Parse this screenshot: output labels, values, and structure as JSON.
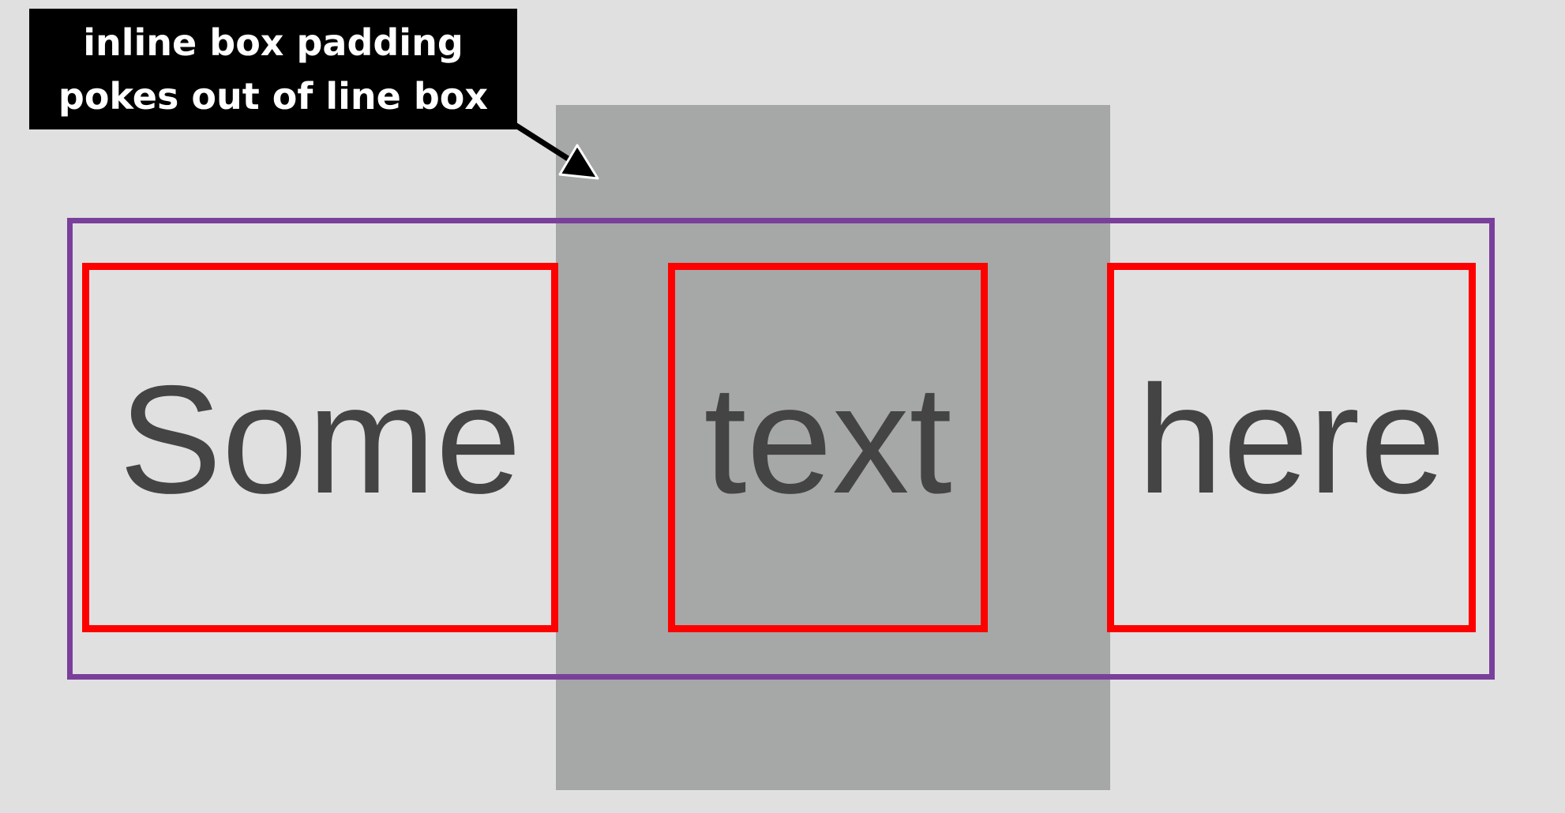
{
  "callout": {
    "line1": "inline box padding",
    "line2": "pokes out of line box"
  },
  "words": [
    {
      "text": "Some"
    },
    {
      "text": "text"
    },
    {
      "text": "here"
    }
  ],
  "colors": {
    "background": "#e0e0e0",
    "padding_area": "#a5a8a6",
    "line_box_border": "#7a3f9b",
    "inline_box_border": "#ff0000",
    "text": "#444444",
    "callout_background": "#000000",
    "callout_text": "#ffffff"
  }
}
